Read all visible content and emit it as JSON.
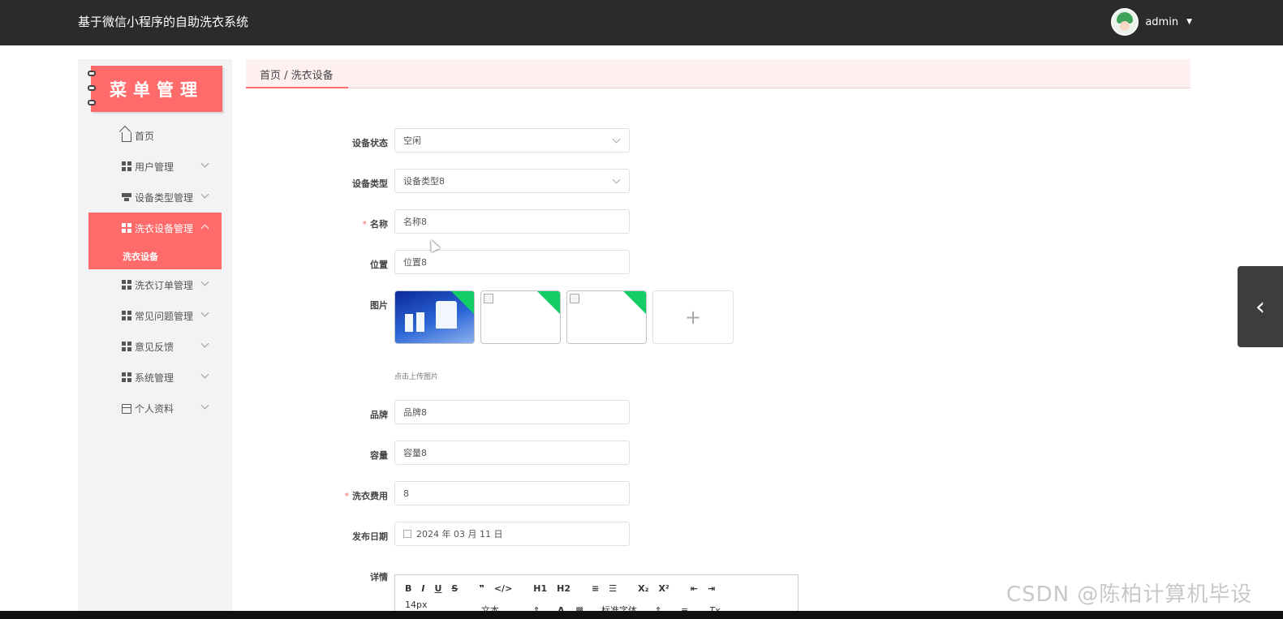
{
  "header": {
    "app_title": "基于微信小程序的自助洗衣系统",
    "username": "admin"
  },
  "sidebar": {
    "logo_text": "菜单管理",
    "items": [
      {
        "label": "首页",
        "icon": "home-icon"
      },
      {
        "label": "用户管理",
        "icon": "grid-icon"
      },
      {
        "label": "设备类型管理",
        "icon": "stack-icon"
      },
      {
        "label": "洗衣设备管理",
        "icon": "grid-icon",
        "active": true
      },
      {
        "label": "洗衣订单管理",
        "icon": "grid-icon"
      },
      {
        "label": "常见问题管理",
        "icon": "grid-icon"
      },
      {
        "label": "意见反馈",
        "icon": "grid-icon"
      },
      {
        "label": "系统管理",
        "icon": "grid-icon"
      },
      {
        "label": "个人资料",
        "icon": "card-icon"
      }
    ],
    "submenu": [
      "洗衣设备"
    ]
  },
  "breadcrumb": "首页 / 洗衣设备",
  "form": {
    "status_label": "设备状态",
    "status_value": "空闲",
    "type_label": "设备类型",
    "type_value": "设备类型8",
    "name_label": "名称",
    "name_value": "名称8",
    "location_label": "位置",
    "location_value": "位置8",
    "image_label": "图片",
    "upload_tip": "点击上传图片",
    "upload_plus": "+",
    "brand_label": "品牌",
    "brand_value": "品牌8",
    "capacity_label": "容量",
    "capacity_value": "容量8",
    "fee_label": "洗衣费用",
    "fee_value": "8",
    "date_label": "发布日期",
    "date_value": "2024 年 03 月 11 日",
    "detail_label": "详情",
    "required_mark": "*"
  },
  "editor": {
    "row1": [
      "B",
      "I",
      "U",
      "S",
      "❞",
      "</>",
      "H1",
      "H2",
      "≡",
      "☰",
      "X₂",
      "X²",
      "⇤",
      "⇥"
    ],
    "font_size": "14px",
    "block_type": "文本",
    "font_family": "标准字体",
    "color_a": "A",
    "clear_format": "Tx"
  },
  "colors": {
    "accent": "#ff6a6a",
    "topbar": "#2b2b2b",
    "success_corner": "#13ce66"
  },
  "watermark": "CSDN @陈柏计算机毕设"
}
